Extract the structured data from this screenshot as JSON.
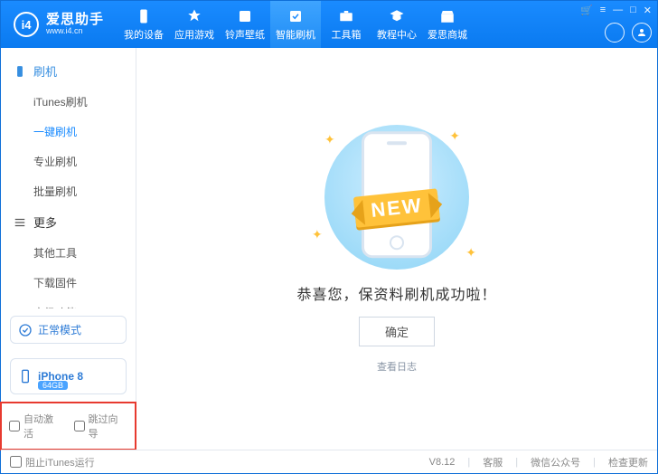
{
  "app": {
    "name": "爱思助手",
    "subtitle": "www.i4.cn",
    "logo_text": "i4"
  },
  "winbtns": {
    "cart": "🛒",
    "menu": "≡",
    "min": "—",
    "max": "□",
    "close": "✕"
  },
  "tabs": [
    {
      "id": "device",
      "label": "我的设备"
    },
    {
      "id": "apps",
      "label": "应用游戏"
    },
    {
      "id": "ring",
      "label": "铃声壁纸"
    },
    {
      "id": "flash",
      "label": "智能刷机"
    },
    {
      "id": "tools",
      "label": "工具箱"
    },
    {
      "id": "tutorial",
      "label": "教程中心"
    },
    {
      "id": "mall",
      "label": "爱思商城"
    }
  ],
  "sidebar": {
    "section1": {
      "title": "刷机",
      "items": [
        "iTunes刷机",
        "一键刷机",
        "专业刷机",
        "批量刷机"
      ]
    },
    "section2": {
      "title": "更多",
      "items": [
        "其他工具",
        "下载固件",
        "高级功能"
      ]
    }
  },
  "mode": {
    "label": "正常模式"
  },
  "device": {
    "name": "iPhone 8",
    "capacity": "64GB"
  },
  "options": {
    "auto_activate": "自动激活",
    "skip_guide": "跳过向导"
  },
  "result": {
    "ribbon": "NEW",
    "message": "恭喜您，保资料刷机成功啦！",
    "confirm": "确定",
    "log": "查看日志"
  },
  "status": {
    "stop_itunes": "阻止iTunes运行",
    "version": "V8.12",
    "service": "客服",
    "wechat": "微信公众号",
    "update": "检查更新"
  }
}
